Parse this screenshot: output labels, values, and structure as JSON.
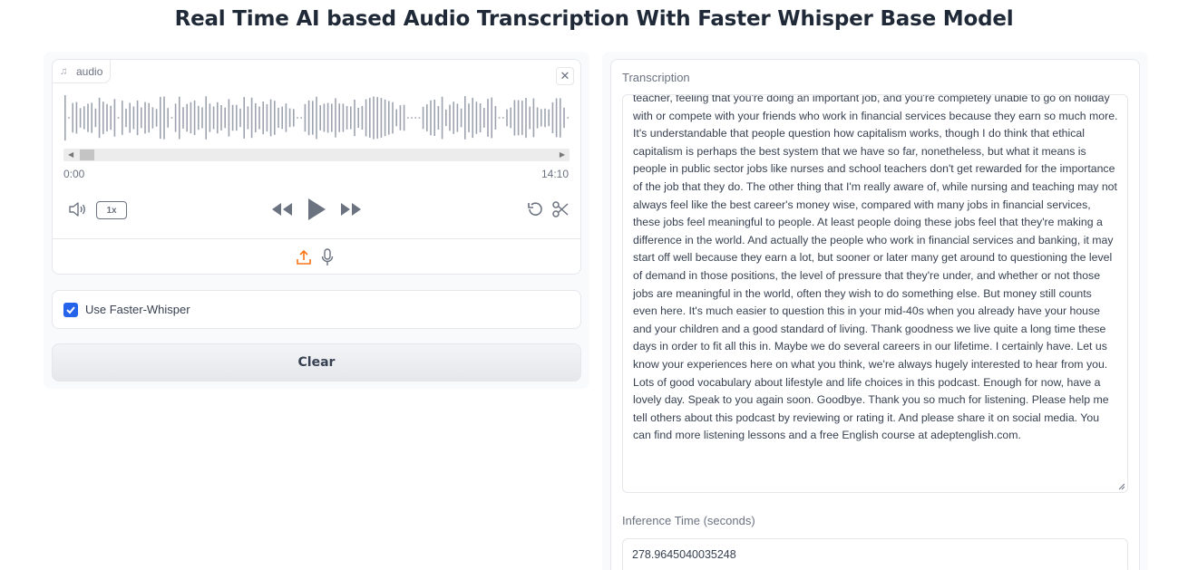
{
  "page_title": "Real Time AI based Audio Transcription With Faster Whisper Base Model",
  "audio": {
    "label": "audio",
    "close_symbol": "✕",
    "time_start": "0:00",
    "time_end": "14:10",
    "speed_label": "1x",
    "icons": [
      "music-note-icon",
      "close-icon",
      "volume-icon",
      "rewind-icon",
      "play-icon",
      "fast-forward-icon",
      "undo-icon",
      "scissors-icon",
      "upload-icon",
      "microphone-icon"
    ],
    "accent_color": "#f97316"
  },
  "options": {
    "checkbox_label": "Use Faster-Whisper",
    "checked": true,
    "checkbox_color": "#2563eb"
  },
  "clear_label": "Clear",
  "transcription": {
    "label": "Transcription",
    "text": "teacher,  feeling that you're doing an important job,  and you're completely unable to go on holiday with or compete  with your friends who work in financial services  because they earn so much more.  It's understandable that people question how capitalism works,  though I do think that ethical capitalism  is perhaps the best system that we have so far, nonetheless,  but what it means is people in public sector jobs  like nurses and school teachers don't get rewarded  for the importance of the job that they do.  The other thing that I'm really aware of,  while nursing and teaching may not always feel  like the best career's money wise,  compared with many jobs in financial services,  these jobs feel meaningful to people.  At least people doing these jobs  feel that they're making a difference in the world.  And actually the people who work in financial services  and banking, it may start off well because they earn a lot,  but sooner or later many get around to questioning  the level of demand in those positions,  the level of pressure that they're under,  and whether or not those jobs are meaningful in the world,  often they wish to do something else.  But money still counts even here.  It's much easier to question this in your mid-40s  when you already have your house and your children  and a good standard of living.  Thank goodness we live quite a long time these days  in order to fit all this in.  Maybe we do several careers in our lifetime.  I certainly have.  Let us know your experiences here on what you think,  we're always hugely interested to hear from you.  Lots of good vocabulary about lifestyle  and life choices in this podcast.  Enough for now, have a lovely day.  Speak to you again soon. Goodbye.  Thank you so much for listening.  Please help me tell others about this podcast  by reviewing or rating it.  And please share it on social media.  You can find more listening lessons  and a free English course at adeptenglish.com."
  },
  "inference": {
    "label": "Inference Time (seconds)",
    "value": "278.9645040035248"
  }
}
